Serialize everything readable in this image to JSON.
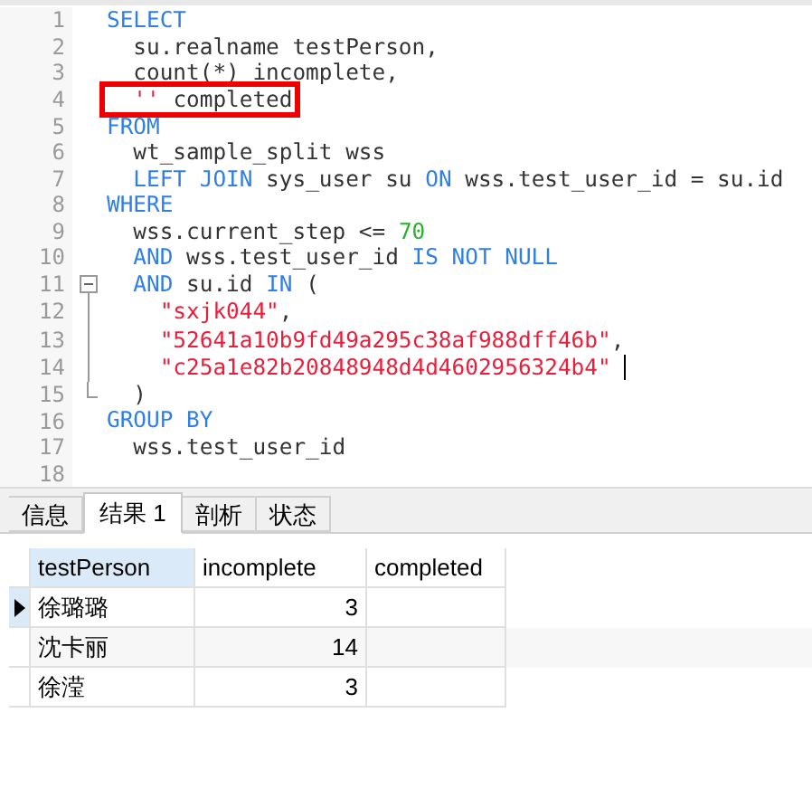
{
  "editor": {
    "lines": [
      {
        "number": "1",
        "tokens": [
          {
            "kind": "kw",
            "text": "SELECT"
          }
        ]
      },
      {
        "number": "2",
        "tokens": [
          {
            "kind": "plain",
            "text": "  su.realname testPerson,"
          }
        ]
      },
      {
        "number": "3",
        "tokens": [
          {
            "kind": "plain",
            "text": "  count(*) incomplete,"
          }
        ]
      },
      {
        "number": "4",
        "highlighted": true,
        "tokens": [
          {
            "kind": "str",
            "text": "  ''"
          },
          {
            "kind": "plain",
            "text": " completed"
          }
        ]
      },
      {
        "number": "5",
        "tokens": [
          {
            "kind": "kw",
            "text": "FROM"
          }
        ]
      },
      {
        "number": "6",
        "tokens": [
          {
            "kind": "plain",
            "text": "  wt_sample_split wss"
          }
        ]
      },
      {
        "number": "7",
        "tokens": [
          {
            "kind": "kw",
            "text": "  LEFT JOIN"
          },
          {
            "kind": "plain",
            "text": " sys_user su "
          },
          {
            "kind": "kw",
            "text": "ON"
          },
          {
            "kind": "plain",
            "text": " wss.test_user_id = su.id"
          }
        ]
      },
      {
        "number": "8",
        "tokens": [
          {
            "kind": "kw",
            "text": "WHERE"
          }
        ]
      },
      {
        "number": "9",
        "tokens": [
          {
            "kind": "plain",
            "text": "  wss.current_step <= "
          },
          {
            "kind": "num",
            "text": "70"
          }
        ]
      },
      {
        "number": "10",
        "tokens": [
          {
            "kind": "kw",
            "text": "  AND"
          },
          {
            "kind": "plain",
            "text": " wss.test_user_id "
          },
          {
            "kind": "kw",
            "text": "IS NOT NULL"
          }
        ]
      },
      {
        "number": "11",
        "fold_toggle": true,
        "tokens": [
          {
            "kind": "kw",
            "text": "  AND"
          },
          {
            "kind": "plain",
            "text": " su.id "
          },
          {
            "kind": "kw",
            "text": "IN"
          },
          {
            "kind": "plain",
            "text": " ("
          }
        ]
      },
      {
        "number": "12",
        "in_fold": true,
        "tokens": [
          {
            "kind": "str",
            "text": "    \"sxjk044\""
          },
          {
            "kind": "plain",
            "text": ","
          }
        ]
      },
      {
        "number": "13",
        "in_fold": true,
        "tokens": [
          {
            "kind": "str",
            "text": "    \"52641a10b9fd49a295c38af988dff46b\""
          },
          {
            "kind": "plain",
            "text": ","
          }
        ]
      },
      {
        "number": "14",
        "in_fold": true,
        "cursor": true,
        "tokens": [
          {
            "kind": "str",
            "text": "    \"c25a1e82b20848948d4d4602956324b4\""
          }
        ]
      },
      {
        "number": "15",
        "in_fold": true,
        "tokens": [
          {
            "kind": "plain",
            "text": "  )"
          }
        ]
      },
      {
        "number": "16",
        "tokens": [
          {
            "kind": "kw",
            "text": "GROUP BY"
          }
        ]
      },
      {
        "number": "17",
        "tokens": [
          {
            "kind": "plain",
            "text": "  wss.test_user_id"
          }
        ]
      },
      {
        "number": "18"
      }
    ]
  },
  "tabs": [
    {
      "label": "信息",
      "selected": false
    },
    {
      "label": "结果 1",
      "selected": true
    },
    {
      "label": "剖析",
      "selected": false
    },
    {
      "label": "状态",
      "selected": false
    }
  ],
  "table": {
    "columns": [
      {
        "label": "testPerson",
        "selected": true,
        "kind": "text"
      },
      {
        "label": "incomplete",
        "selected": false,
        "kind": "number"
      },
      {
        "label": "completed",
        "selected": false,
        "kind": "text"
      }
    ],
    "rows": [
      {
        "current": true,
        "cells": [
          "徐璐璐",
          "3",
          ""
        ]
      },
      {
        "current": false,
        "cells": [
          "沈卡丽",
          "14",
          ""
        ]
      },
      {
        "current": false,
        "cells": [
          "徐滢",
          "3",
          ""
        ]
      }
    ]
  }
}
